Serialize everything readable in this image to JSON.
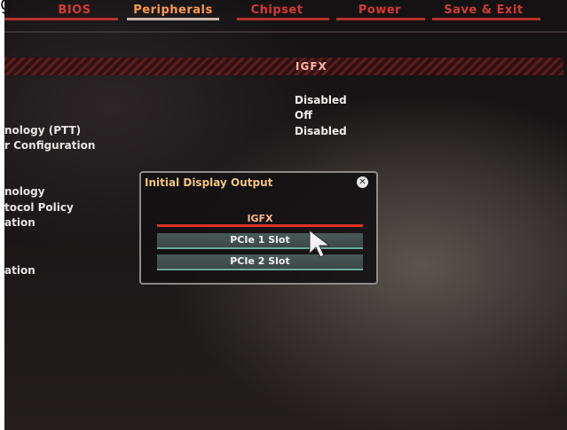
{
  "caption_fragment": "g",
  "tabs": [
    {
      "label": "BIOS"
    },
    {
      "label": "Peripherals"
    },
    {
      "label": "Chipset"
    },
    {
      "label": "Power"
    },
    {
      "label": "Save & Exit"
    }
  ],
  "section": {
    "title": "IGFX"
  },
  "left_labels": [
    "nology (PTT)",
    "r Configuration",
    "nology",
    "tocol Policy",
    "ation",
    "ation"
  ],
  "values": [
    "Disabled",
    "Off",
    "Disabled"
  ],
  "popup": {
    "title": "Initial Display Output",
    "close_glyph": "✕",
    "options": [
      {
        "label": "IGFX",
        "selected": true
      },
      {
        "label": "PCIe 1 Slot",
        "selected": false
      },
      {
        "label": "PCIe 2 Slot",
        "selected": false
      }
    ]
  },
  "colors": {
    "accent_red": "#d63a33",
    "active_tab": "#ff9a4c",
    "popup_title": "#f2c57a"
  }
}
